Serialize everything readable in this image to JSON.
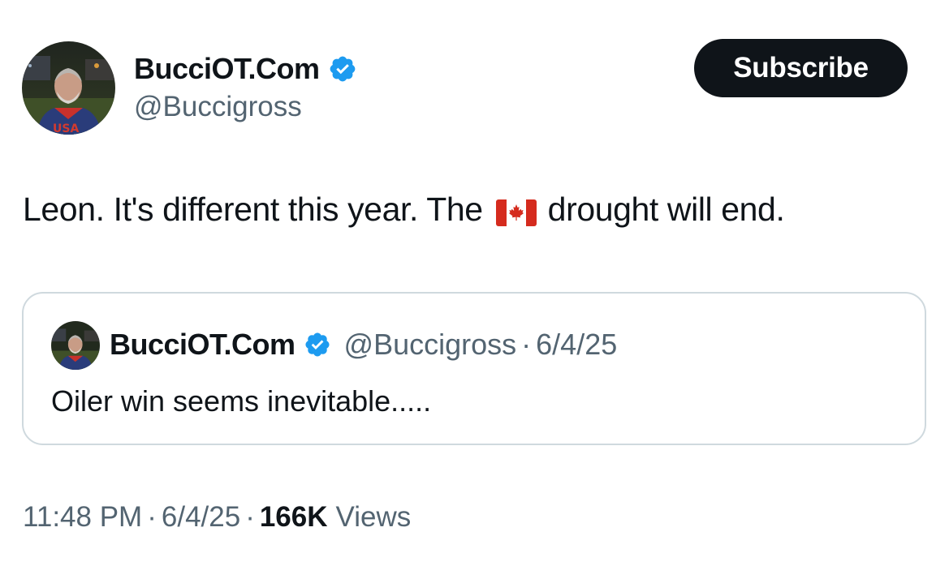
{
  "author": {
    "display_name": "BucciOT.Com",
    "handle": "@Buccigross",
    "verified_icon": "verified-badge-icon",
    "avatar": "avatar-image"
  },
  "subscribe_label": "Subscribe",
  "tweet": {
    "text_before": "Leon. It's different this year. The",
    "emoji": "canada-flag-icon",
    "text_after": "drought will end."
  },
  "quote": {
    "display_name": "BucciOT.Com",
    "handle": "@Buccigross",
    "separator": "·",
    "date": "6/4/25",
    "text": "Oiler win seems inevitable....."
  },
  "footer": {
    "time": "11:48 PM",
    "separator": "·",
    "date": "6/4/25",
    "views_count": "166K",
    "views_label": "Views"
  },
  "colors": {
    "text_primary": "#0f1419",
    "text_secondary": "#536471",
    "verified": "#1d9bf0",
    "border": "#cfd9de"
  }
}
